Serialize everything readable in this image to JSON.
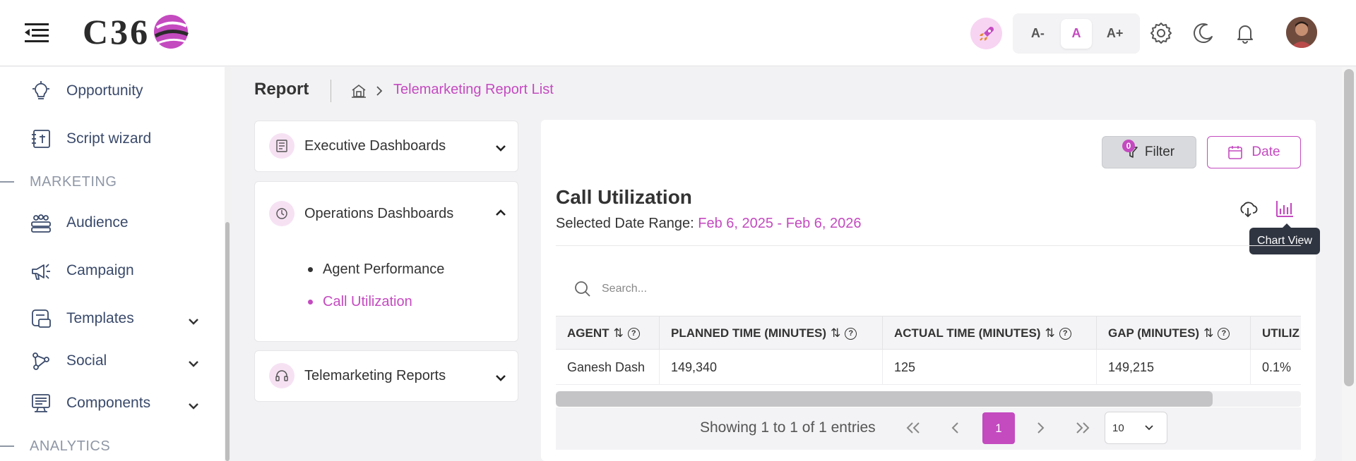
{
  "header": {
    "logo_text": "C36",
    "font_controls": {
      "decrease": "A-",
      "normal": "A",
      "increase": "A+",
      "active": "A"
    }
  },
  "sidebar": {
    "items": [
      {
        "label": "Opportunity",
        "icon": "lightbulb-icon"
      },
      {
        "label": "Script wizard",
        "icon": "script-icon"
      },
      {
        "label": "Audience",
        "icon": "audience-icon"
      },
      {
        "label": "Campaign",
        "icon": "megaphone-icon"
      },
      {
        "label": "Templates",
        "icon": "templates-icon",
        "expandable": true
      },
      {
        "label": "Social",
        "icon": "share-icon",
        "expandable": true
      },
      {
        "label": "Components",
        "icon": "components-icon",
        "expandable": true
      }
    ],
    "sections": {
      "marketing": "MARKETING",
      "analytics": "ANALYTICS"
    }
  },
  "page": {
    "title": "Report",
    "breadcrumb": {
      "current": "Telemarketing Report List"
    }
  },
  "accordion": {
    "executive": {
      "label": "Executive Dashboards",
      "expanded": false
    },
    "operations": {
      "label": "Operations Dashboards",
      "expanded": true,
      "items": [
        {
          "label": "Agent Performance",
          "active": false
        },
        {
          "label": "Call Utilization",
          "active": true
        }
      ]
    },
    "telemarketing": {
      "label": "Telemarketing Reports",
      "expanded": false
    }
  },
  "report": {
    "filter_label": "Filter",
    "filter_count": "0",
    "date_label": "Date",
    "title": "Call Utilization",
    "range_label": "Selected Date Range:",
    "range_value": "Feb 6, 2025 - Feb 6, 2026",
    "tooltip": "Chart View",
    "search_placeholder": "Search...",
    "columns": [
      "AGENT",
      "PLANNED TIME (MINUTES)",
      "ACTUAL TIME (MINUTES)",
      "GAP (MINUTES)",
      "UTILIZ"
    ],
    "rows": [
      [
        "Ganesh Dash",
        "149,340",
        "125",
        "149,215",
        "0.1%"
      ]
    ],
    "pagination": {
      "summary": "Showing 1 to 1 of 1 entries",
      "current_page": "1",
      "page_size": "10"
    }
  },
  "colors": {
    "accent": "#c44ac0",
    "accent_light": "#f6e1f3",
    "tooltip_bg": "#2f3541"
  }
}
